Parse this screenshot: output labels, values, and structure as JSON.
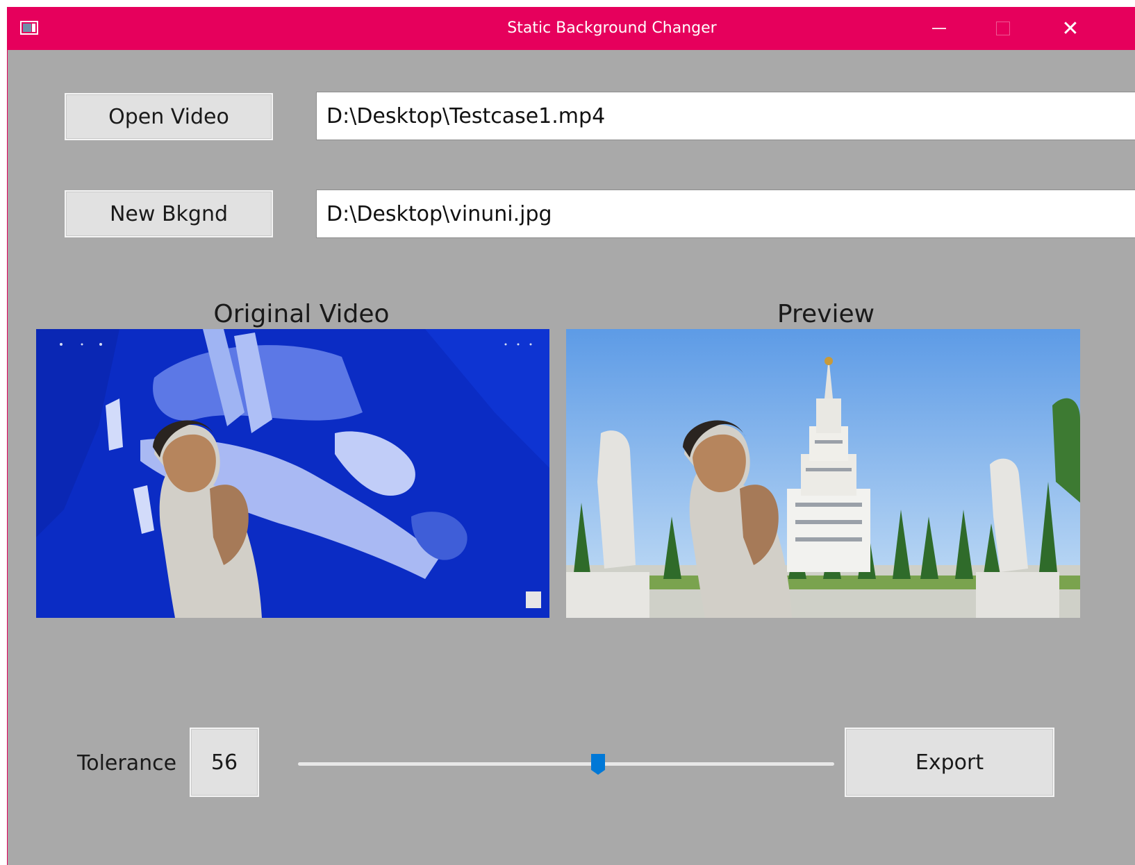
{
  "window": {
    "title": "Static Background Changer",
    "accent_color": "#e6005c",
    "background_color": "#a9a9a9",
    "controls": [
      "minimize-icon",
      "maximize-icon",
      "close-icon"
    ],
    "close_glyph": "✕"
  },
  "inputs": {
    "open_video_label": "Open Video",
    "video_path": "D:\\Desktop\\Testcase1.mp4",
    "new_background_label": "New Bkgnd",
    "background_path": "D:\\Desktop\\vinuni.jpg"
  },
  "panels": {
    "original_label": "Original Video",
    "preview_label": "Preview"
  },
  "tolerance": {
    "label": "Tolerance",
    "value": "56",
    "slider_fraction": 0.56,
    "slider_accent": "#0078d7"
  },
  "actions": {
    "export_label": "Export"
  }
}
